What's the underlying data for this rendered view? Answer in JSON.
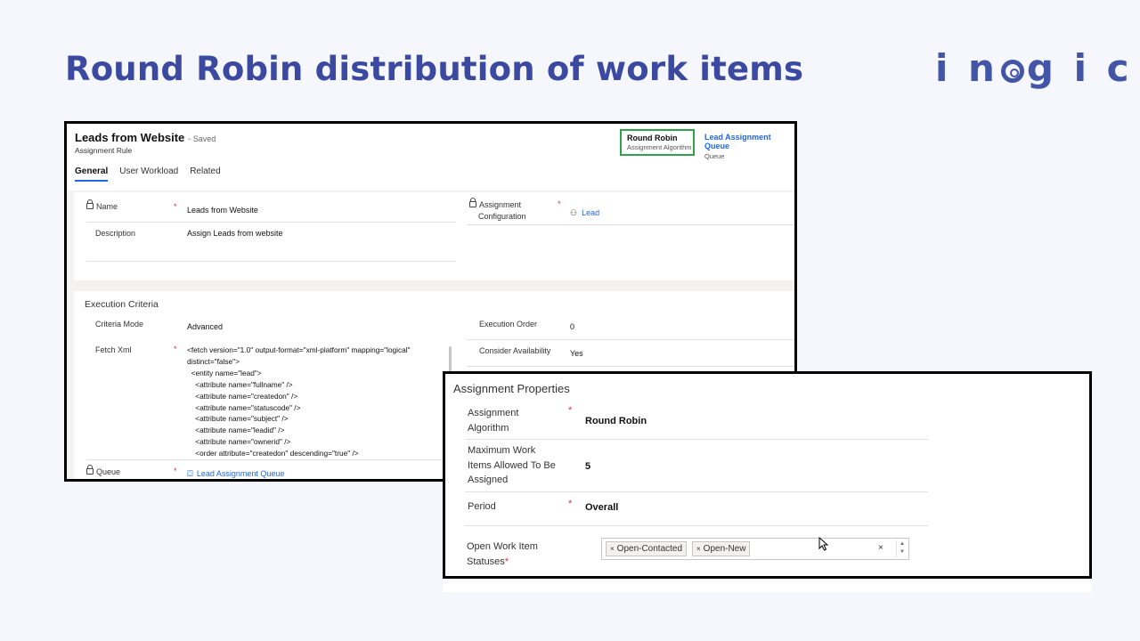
{
  "slide": {
    "title": "Round Robin distribution of work items",
    "logo": "inogic"
  },
  "record": {
    "title": "Leads from Website",
    "saved": "- Saved",
    "type": "Assignment Rule",
    "algorithm_value": "Round Robin",
    "algorithm_label": "Assignment Algorithm",
    "queue_value": "Lead Assignment Queue",
    "queue_label": "Queue"
  },
  "tabs": [
    "General",
    "User Workload",
    "Related"
  ],
  "general": {
    "name_label": "Name",
    "name_value": "Leads from Website",
    "description_label": "Description",
    "description_value": "Assign Leads from website",
    "assign_config_label_1": "Assignment",
    "assign_config_label_2": "Configuration",
    "assign_config_value": "Lead",
    "required_mark": "*"
  },
  "execution": {
    "title": "Execution Criteria",
    "criteria_mode_label": "Criteria Mode",
    "criteria_mode_value": "Advanced",
    "execution_order_label": "Execution Order",
    "execution_order_value": "0",
    "consider_availability_label": "Consider Availability",
    "consider_availability_value": "Yes",
    "fetch_xml_label": "Fetch Xml",
    "fetch_xml_lines": [
      "<fetch version=\"1.0\" output-format=\"xml-platform\" mapping=\"logical\"",
      "distinct=\"false\">",
      "  <entity name=\"lead\">",
      "    <attribute name=\"fullname\" />",
      "    <attribute name=\"createdon\" />",
      "    <attribute name=\"statuscode\" />",
      "    <attribute name=\"subject\" />",
      "    <attribute name=\"leadid\" />",
      "    <attribute name=\"ownerid\" />",
      "    <order attribute=\"createdon\" descending=\"true\" />"
    ],
    "queue_label": "Queue",
    "queue_value": "Lead Assignment Queue"
  },
  "assignment_properties": {
    "title": "Assignment Properties",
    "algorithm_label_1": "Assignment",
    "algorithm_label_2": "Algorithm",
    "algorithm_value": "Round Robin",
    "max_items_label_1": "Maximum Work",
    "max_items_label_2": "Items Allowed To Be",
    "max_items_label_3": "Assigned",
    "max_items_value": "5",
    "period_label": "Period",
    "period_value": "Overall",
    "statuses_label_1": "Open Work Item",
    "statuses_label_2": "Statuses",
    "statuses_tags": [
      "Open-Contacted",
      "Open-New"
    ],
    "tag_remove": "×",
    "clear_all": "×"
  },
  "colors": {
    "accent": "#2266e3",
    "title": "#3b4aa0",
    "highlight": "#2fa34a",
    "required": "#d13438"
  }
}
